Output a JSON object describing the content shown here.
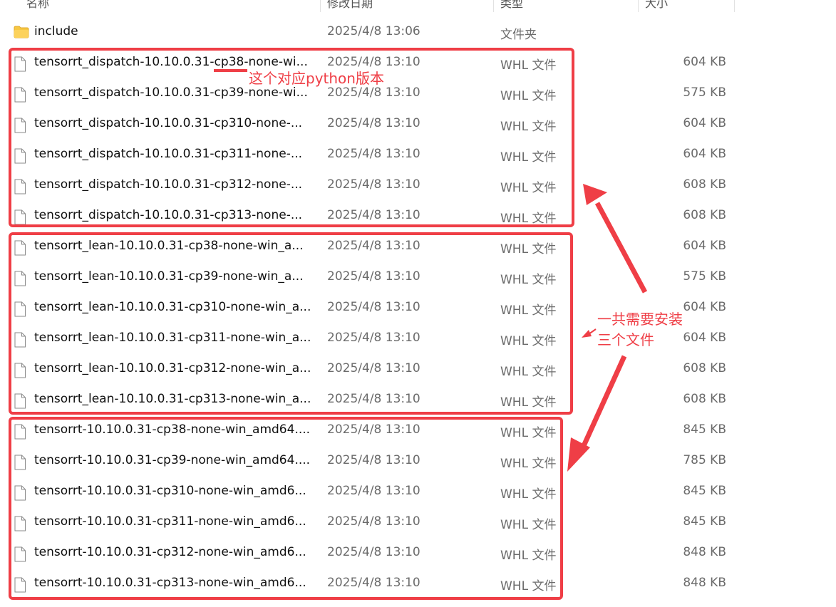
{
  "columns": {
    "name": "名称",
    "date": "修改日期",
    "type": "类型",
    "size": "大小"
  },
  "rows": [
    {
      "icon": "folder-icon",
      "name": "include",
      "date": "2025/4/8 13:06",
      "type": "文件夹",
      "size": ""
    },
    {
      "icon": "file-icon",
      "name": "tensorrt_dispatch-10.10.0.31-cp38-none-wi...",
      "date": "2025/4/8 13:10",
      "type": "WHL 文件",
      "size": "604 KB"
    },
    {
      "icon": "file-icon",
      "name": "tensorrt_dispatch-10.10.0.31-cp39-none-wi...",
      "date": "2025/4/8 13:10",
      "type": "WHL 文件",
      "size": "575 KB"
    },
    {
      "icon": "file-icon",
      "name": "tensorrt_dispatch-10.10.0.31-cp310-none-...",
      "date": "2025/4/8 13:10",
      "type": "WHL 文件",
      "size": "604 KB"
    },
    {
      "icon": "file-icon",
      "name": "tensorrt_dispatch-10.10.0.31-cp311-none-...",
      "date": "2025/4/8 13:10",
      "type": "WHL 文件",
      "size": "604 KB"
    },
    {
      "icon": "file-icon",
      "name": "tensorrt_dispatch-10.10.0.31-cp312-none-...",
      "date": "2025/4/8 13:10",
      "type": "WHL 文件",
      "size": "608 KB"
    },
    {
      "icon": "file-icon",
      "name": "tensorrt_dispatch-10.10.0.31-cp313-none-...",
      "date": "2025/4/8 13:10",
      "type": "WHL 文件",
      "size": "608 KB"
    },
    {
      "icon": "file-icon",
      "name": "tensorrt_lean-10.10.0.31-cp38-none-win_a...",
      "date": "2025/4/8 13:10",
      "type": "WHL 文件",
      "size": "604 KB"
    },
    {
      "icon": "file-icon",
      "name": "tensorrt_lean-10.10.0.31-cp39-none-win_a...",
      "date": "2025/4/8 13:10",
      "type": "WHL 文件",
      "size": "575 KB"
    },
    {
      "icon": "file-icon",
      "name": "tensorrt_lean-10.10.0.31-cp310-none-win_a...",
      "date": "2025/4/8 13:10",
      "type": "WHL 文件",
      "size": "604 KB"
    },
    {
      "icon": "file-icon",
      "name": "tensorrt_lean-10.10.0.31-cp311-none-win_a...",
      "date": "2025/4/8 13:10",
      "type": "WHL 文件",
      "size": "604 KB"
    },
    {
      "icon": "file-icon",
      "name": "tensorrt_lean-10.10.0.31-cp312-none-win_a...",
      "date": "2025/4/8 13:10",
      "type": "WHL 文件",
      "size": "608 KB"
    },
    {
      "icon": "file-icon",
      "name": "tensorrt_lean-10.10.0.31-cp313-none-win_a...",
      "date": "2025/4/8 13:10",
      "type": "WHL 文件",
      "size": "608 KB"
    },
    {
      "icon": "file-icon",
      "name": "tensorrt-10.10.0.31-cp38-none-win_amd64....",
      "date": "2025/4/8 13:10",
      "type": "WHL 文件",
      "size": "845 KB"
    },
    {
      "icon": "file-icon",
      "name": "tensorrt-10.10.0.31-cp39-none-win_amd64....",
      "date": "2025/4/8 13:10",
      "type": "WHL 文件",
      "size": "785 KB"
    },
    {
      "icon": "file-icon",
      "name": "tensorrt-10.10.0.31-cp310-none-win_amd6...",
      "date": "2025/4/8 13:10",
      "type": "WHL 文件",
      "size": "845 KB"
    },
    {
      "icon": "file-icon",
      "name": "tensorrt-10.10.0.31-cp311-none-win_amd6...",
      "date": "2025/4/8 13:10",
      "type": "WHL 文件",
      "size": "845 KB"
    },
    {
      "icon": "file-icon",
      "name": "tensorrt-10.10.0.31-cp312-none-win_amd6...",
      "date": "2025/4/8 13:10",
      "type": "WHL 文件",
      "size": "848 KB"
    },
    {
      "icon": "file-icon",
      "name": "tensorrt-10.10.0.31-cp313-none-win_amd6...",
      "date": "2025/4/8 13:10",
      "type": "WHL 文件",
      "size": "848 KB"
    }
  ],
  "annotations": {
    "python_version_note": "这个对应python版本",
    "install_note_line1": "一共需要安装",
    "install_note_line2": "三个文件",
    "color": "#ef3e46"
  }
}
